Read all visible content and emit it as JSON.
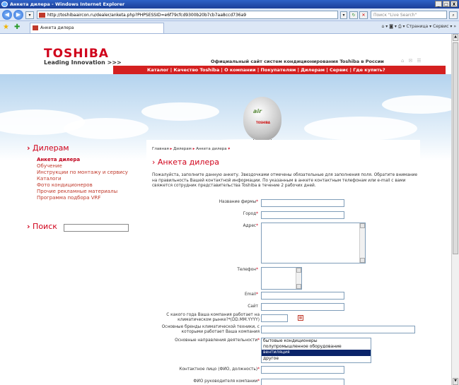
{
  "window": {
    "title": "Анкета дилера - Windows Internet Explorer",
    "buttons": [
      "_",
      "□",
      "X"
    ]
  },
  "address": {
    "url": "http://toshibaaircon.ru/dealer/anketa.php?PHPSESSID=e6f79cfcd9300b20b7cb7aa8ccd736a9",
    "search_placeholder": "Поиск \"Live Search\""
  },
  "tab": {
    "label": "Анкета дилера"
  },
  "commandbar": {
    "text": "Страница ▾   Сервис ▾"
  },
  "header": {
    "logo": "TOSHIBA",
    "tagline": "Leading Innovation >>>",
    "official": "Официальный сайт систем кондиционирования Toshiba в России",
    "nav": "Каталог | Качество Toshiba | О компании | Покупателям | Дилерам | Сервис | Где купить?"
  },
  "banner": {
    "balloon_text": "air",
    "balloon_brand": "TOSHIBA"
  },
  "sidebar": {
    "dealers_title": "Дилерам",
    "items": [
      "Анкета дилера",
      "Обучение",
      "Инструкции по монтажу и сервису",
      "Каталоги",
      "Фото кондиционеров",
      "Прочие рекламные материалы",
      "Программа подбора VRF"
    ],
    "search_title": "Поиск"
  },
  "main": {
    "breadcrumb": [
      "Главная",
      "Дилерам",
      "Анкета дилера"
    ],
    "title": "Анкета дилера",
    "intro": "Пожалуйста, заполните данную анкету. Звездочками отмечены обязательные для заполнения поля. Обратите внимание на правильность Вашей контактной информации. По указанным в анкете контактным телефонам или e-mail с вами свяжется сотрудник представительства Toshiba в течение 2 рабочих дней.",
    "form": {
      "company": "Название фирмы",
      "city": "Город",
      "address": "Адрес",
      "phone": "Телефон",
      "email": "Email",
      "site": "Сайт",
      "year_line1": "С какого года Ваша компания работает на",
      "year_line2": "климатическом рынке?*(DD.MM.YYYY)",
      "brands_line1": "Основные бренды климатической техники, с",
      "brands_line2": "которыми работает Ваша компания",
      "directions": "Основные направления деятельности",
      "contact": "Контактное лицо (ФИО, должность)",
      "director": "ФИО руководителя компании",
      "req": "*",
      "directions_options": [
        "бытовые кондиционеры",
        "полупромышленное оборудование",
        "вентиляция",
        "другое"
      ],
      "directions_selected_index": 2
    }
  }
}
